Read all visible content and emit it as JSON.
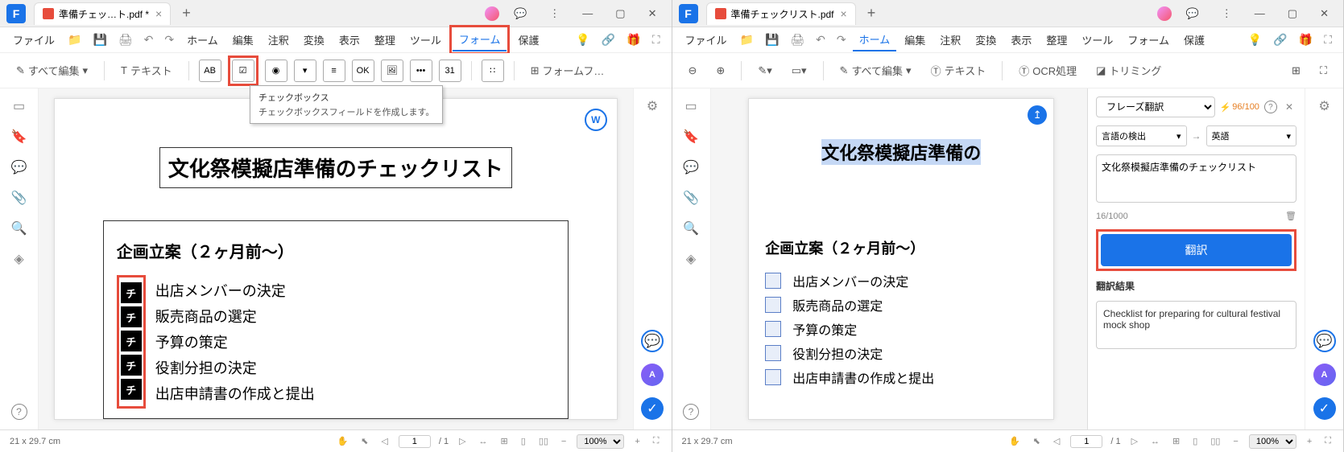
{
  "left": {
    "title_bar": {
      "tab_title": "準備チェッ…ト.pdf *"
    },
    "menu": {
      "file": "ファイル",
      "items": [
        "ホーム",
        "編集",
        "注釈",
        "変換",
        "表示",
        "整理",
        "ツール",
        "フォーム",
        "保護"
      ],
      "active_index": 7
    },
    "toolbar": {
      "edit_all": "すべて編集",
      "text": "テキスト",
      "form_fields": "フォームフ…",
      "icons": [
        "AB",
        "☑",
        "◉",
        "▾",
        "≡",
        "OK",
        "🖼",
        "•••",
        "31",
        "∷"
      ]
    },
    "tooltip": {
      "title": "チェックボックス",
      "desc": "チェックボックスフィールドを作成します。"
    },
    "doc": {
      "title": "文化祭模擬店準備のチェックリスト",
      "section": "企画立案（２ヶ月前〜）",
      "check_label": "チ",
      "items": [
        "出店メンバーの決定",
        "販売商品の選定",
        "予算の策定",
        "役割分担の決定",
        "出店申請書の作成と提出"
      ]
    },
    "status": {
      "size": "21 x 29.7 cm",
      "page": "1",
      "pages": "/ 1",
      "zoom": "100%"
    }
  },
  "right": {
    "title_bar": {
      "tab_title": "準備チェックリスト.pdf"
    },
    "menu": {
      "file": "ファイル",
      "items": [
        "ホーム",
        "編集",
        "注釈",
        "変換",
        "表示",
        "整理",
        "ツール",
        "フォーム",
        "保護"
      ],
      "active_index": 0
    },
    "toolbar": {
      "edit_all": "すべて編集",
      "text": "テキスト",
      "ocr": "OCR処理",
      "trimming": "トリミング"
    },
    "doc": {
      "title": "文化祭模擬店準備の",
      "section": "企画立案（２ヶ月前〜）",
      "items": [
        "出店メンバーの決定",
        "販売商品の選定",
        "予算の策定",
        "役割分担の決定",
        "出店申請書の作成と提出"
      ]
    },
    "translate": {
      "mode": "フレーズ翻訳",
      "counter": "96/100",
      "lang_from": "言語の検出",
      "lang_to": "英語",
      "input": "文化祭模擬店準備のチェックリスト",
      "char_count": "16/1000",
      "btn": "翻訳",
      "result_label": "翻訳結果",
      "result": "Checklist for preparing for cultural festival mock shop"
    },
    "status": {
      "size": "21 x 29.7 cm",
      "page": "1",
      "pages": "/ 1",
      "zoom": "100%"
    }
  }
}
